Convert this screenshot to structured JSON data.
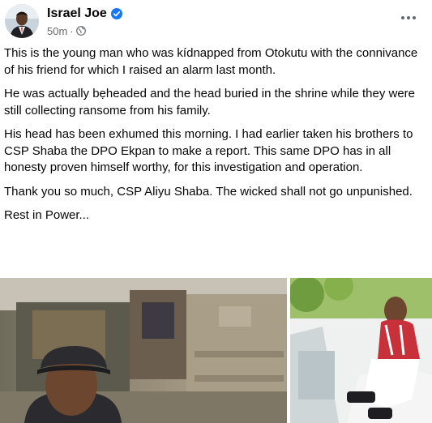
{
  "post": {
    "author_name": "Israel Joe",
    "time_ago": "50m",
    "separator": "·",
    "paragraphs": [
      "This is the young man who was kídnapped from Otokutu with the connivance of his friend for which I raised an alarm last month.",
      "He was actually bẹheaded and the head buried in the shrine while they were still collecting ransome from his family.",
      "His head has been exhumed this morning. I had earlier taken his brothers to CSP Shaba the DPO Ekpan to make a report. This same DPO has in all honesty proven himself worthy, for this investigation and operation.",
      "Thank you so much, CSP Aliyu Shaba. The wicked shall not go unpunished.",
      "Rest in Power..."
    ]
  },
  "icons": {
    "verified": "verified-badge-icon",
    "privacy": "globe-icon",
    "more": "more-options-icon"
  },
  "colors": {
    "verified_blue": "#1877f2",
    "secondary_text": "#65676b",
    "primary_text": "#050505"
  }
}
